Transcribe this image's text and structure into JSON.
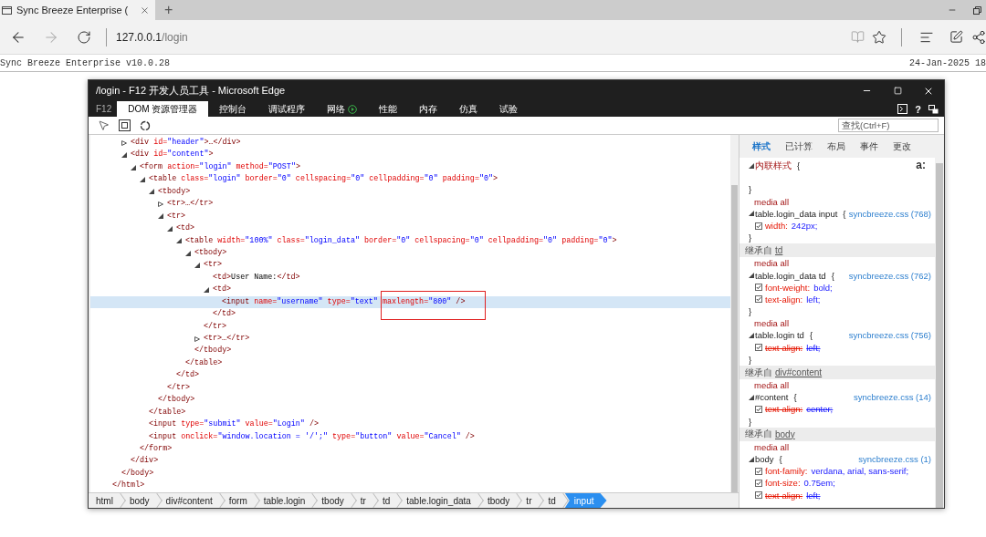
{
  "browser": {
    "tab_title": "Sync Breeze Enterprise (",
    "new_tab": "+",
    "url_host": "127.0.0.1",
    "url_path": "/login"
  },
  "page_header": {
    "title": "Sync Breeze Enterprise v10.0.28",
    "date": "24-Jan-2025 18"
  },
  "devtools": {
    "title": "/login - F12 开发人员工具 - Microsoft Edge",
    "help": "?",
    "tabs": [
      {
        "kind": "label",
        "label": "F12",
        "selected": false
      },
      {
        "kind": "tab",
        "label": "DOM 资源管理器",
        "selected": true
      },
      {
        "kind": "tab",
        "label": "控制台",
        "selected": false
      },
      {
        "kind": "tab",
        "label": "调试程序",
        "selected": false
      },
      {
        "kind": "play",
        "label": "网络",
        "selected": false
      },
      {
        "kind": "tab",
        "label": "性能",
        "selected": false
      },
      {
        "kind": "tab",
        "label": "内存",
        "selected": false
      },
      {
        "kind": "tab",
        "label": "仿真",
        "selected": false
      },
      {
        "kind": "tab",
        "label": "试验",
        "selected": false
      }
    ],
    "search": {
      "placeholder": "查找(Ctrl+F)"
    },
    "dom_tree": [
      {
        "close": [
          {
            "kind": "tag",
            "text": "</html>"
          }
        ],
        "children": [
          {
            "close": [
              {
                "kind": "tag",
                "text": "</body>"
              }
            ],
            "children": [
              {
                "selected": false,
                "expanded": false,
                "tokens": [
                  {
                    "kind": "tag",
                    "text": "<div"
                  },
                  {
                    "kind": "attr",
                    "text": " id="
                  },
                  {
                    "kind": "value",
                    "text": "\"header\""
                  },
                  {
                    "kind": "tag",
                    "text": ">…</div>"
                  }
                ]
              },
              {
                "selected": false,
                "expanded": true,
                "tokens": [
                  {
                    "kind": "tag",
                    "text": "<div"
                  },
                  {
                    "kind": "attr",
                    "text": " id="
                  },
                  {
                    "kind": "value",
                    "text": "\"content\""
                  },
                  {
                    "kind": "tag",
                    "text": ">"
                  }
                ],
                "close": [
                  {
                    "kind": "tag",
                    "text": "</div>"
                  }
                ],
                "children": [
                  {
                    "selected": false,
                    "expanded": true,
                    "tokens": [
                      {
                        "kind": "tag",
                        "text": "<form"
                      },
                      {
                        "kind": "attr",
                        "text": " action="
                      },
                      {
                        "kind": "value",
                        "text": "\"login\""
                      },
                      {
                        "kind": "attr",
                        "text": " method="
                      },
                      {
                        "kind": "value",
                        "text": "\"POST\""
                      },
                      {
                        "kind": "tag",
                        "text": ">"
                      }
                    ],
                    "close": [
                      {
                        "kind": "tag",
                        "text": "</form>"
                      }
                    ],
                    "children": [
                      {
                        "selected": false,
                        "expanded": true,
                        "tokens": [
                          {
                            "kind": "tag",
                            "text": "<table"
                          },
                          {
                            "kind": "attr",
                            "text": " class="
                          },
                          {
                            "kind": "value",
                            "text": "\"login\""
                          },
                          {
                            "kind": "attr",
                            "text": " border="
                          },
                          {
                            "kind": "value",
                            "text": "\"0\""
                          },
                          {
                            "kind": "attr",
                            "text": " cellspacing="
                          },
                          {
                            "kind": "value",
                            "text": "\"0\""
                          },
                          {
                            "kind": "attr",
                            "text": " cellpadding="
                          },
                          {
                            "kind": "value",
                            "text": "\"0\""
                          },
                          {
                            "kind": "attr",
                            "text": " padding="
                          },
                          {
                            "kind": "value",
                            "text": "\"0\""
                          },
                          {
                            "kind": "tag",
                            "text": ">"
                          }
                        ],
                        "close": [
                          {
                            "kind": "tag",
                            "text": "</table>"
                          }
                        ],
                        "children": [
                          {
                            "selected": false,
                            "expanded": true,
                            "tokens": [
                              {
                                "kind": "tag",
                                "text": "<tbody>"
                              }
                            ],
                            "close": [
                              {
                                "kind": "tag",
                                "text": "</tbody>"
                              }
                            ],
                            "children": [
                              {
                                "selected": false,
                                "expanded": false,
                                "tokens": [
                                  {
                                    "kind": "tag",
                                    "text": "<tr>…</tr>"
                                  }
                                ]
                              },
                              {
                                "selected": false,
                                "expanded": true,
                                "tokens": [
                                  {
                                    "kind": "tag",
                                    "text": "<tr>"
                                  }
                                ],
                                "close": [
                                  {
                                    "kind": "tag",
                                    "text": "</tr>"
                                  }
                                ],
                                "children": [
                                  {
                                    "selected": false,
                                    "expanded": true,
                                    "tokens": [
                                      {
                                        "kind": "tag",
                                        "text": "<td>"
                                      }
                                    ],
                                    "close": [
                                      {
                                        "kind": "tag",
                                        "text": "</td>"
                                      }
                                    ],
                                    "children": [
                                      {
                                        "selected": false,
                                        "expanded": true,
                                        "tokens": [
                                          {
                                            "kind": "tag",
                                            "text": "<table"
                                          },
                                          {
                                            "kind": "attr",
                                            "text": " width="
                                          },
                                          {
                                            "kind": "value",
                                            "text": "\"100%\""
                                          },
                                          {
                                            "kind": "attr",
                                            "text": " class="
                                          },
                                          {
                                            "kind": "value",
                                            "text": "\"login_data\""
                                          },
                                          {
                                            "kind": "attr",
                                            "text": " border="
                                          },
                                          {
                                            "kind": "value",
                                            "text": "\"0\""
                                          },
                                          {
                                            "kind": "attr",
                                            "text": " cellspacing="
                                          },
                                          {
                                            "kind": "value",
                                            "text": "\"0\""
                                          },
                                          {
                                            "kind": "attr",
                                            "text": " cellpadding="
                                          },
                                          {
                                            "kind": "value",
                                            "text": "\"0\""
                                          },
                                          {
                                            "kind": "attr",
                                            "text": " padding="
                                          },
                                          {
                                            "kind": "value",
                                            "text": "\"0\""
                                          },
                                          {
                                            "kind": "tag",
                                            "text": ">"
                                          }
                                        ],
                                        "close": [
                                          {
                                            "kind": "tag",
                                            "text": "</table>"
                                          }
                                        ],
                                        "children": [
                                          {
                                            "selected": false,
                                            "expanded": true,
                                            "tokens": [
                                              {
                                                "kind": "tag",
                                                "text": "<tbody>"
                                              }
                                            ],
                                            "close": [
                                              {
                                                "kind": "tag",
                                                "text": "</tbody>"
                                              }
                                            ],
                                            "children": [
                                              {
                                                "selected": false,
                                                "expanded": true,
                                                "tokens": [
                                                  {
                                                    "kind": "tag",
                                                    "text": "<tr>"
                                                  }
                                                ],
                                                "close": [
                                                  {
                                                    "kind": "tag",
                                                    "text": "</tr>"
                                                  }
                                                ],
                                                "children": [
                                                  {
                                                    "selected": false,
                                                    "tokens": [
                                                      {
                                                        "kind": "tag",
                                                        "text": "<td>"
                                                      },
                                                      {
                                                        "kind": "text",
                                                        "text": "User Name:"
                                                      },
                                                      {
                                                        "kind": "tag",
                                                        "text": "</td>"
                                                      }
                                                    ]
                                                  },
                                                  {
                                                    "selected": false,
                                                    "expanded": true,
                                                    "tokens": [
                                                      {
                                                        "kind": "tag",
                                                        "text": "<td>"
                                                      }
                                                    ],
                                                    "close": [
                                                      {
                                                        "kind": "tag",
                                                        "text": "</td>"
                                                      }
                                                    ],
                                                    "children": [
                                                      {
                                                        "selected": true,
                                                        "tokens": [
                                                          {
                                                            "kind": "tag",
                                                            "text": "<input"
                                                          },
                                                          {
                                                            "kind": "attr",
                                                            "text": " name="
                                                          },
                                                          {
                                                            "kind": "value",
                                                            "text": "\"username\""
                                                          },
                                                          {
                                                            "kind": "attr",
                                                            "text": " type="
                                                          },
                                                          {
                                                            "kind": "value",
                                                            "text": "\"text\""
                                                          },
                                                          {
                                                            "kind": "attr",
                                                            "text": " maxlength=",
                                                            "boxed": true
                                                          },
                                                          {
                                                            "kind": "value",
                                                            "text": "\"800\"",
                                                            "boxed": true
                                                          },
                                                          {
                                                            "kind": "tag",
                                                            "text": " />"
                                                          }
                                                        ]
                                                      }
                                                    ]
                                                  }
                                                ]
                                              },
                                              {
                                                "selected": false,
                                                "expanded": false,
                                                "tokens": [
                                                  {
                                                    "kind": "tag",
                                                    "text": "<tr>…</tr>"
                                                  }
                                                ]
                                              }
                                            ]
                                          }
                                        ]
                                      }
                                    ]
                                  }
                                ]
                              }
                            ]
                          }
                        ]
                      },
                      {
                        "selected": false,
                        "tokens": [
                          {
                            "kind": "tag",
                            "text": "<input"
                          },
                          {
                            "kind": "attr",
                            "text": " type="
                          },
                          {
                            "kind": "value",
                            "text": "\"submit\""
                          },
                          {
                            "kind": "attr",
                            "text": " value="
                          },
                          {
                            "kind": "value",
                            "text": "\"Login\""
                          },
                          {
                            "kind": "tag",
                            "text": " />"
                          }
                        ]
                      },
                      {
                        "selected": false,
                        "tokens": [
                          {
                            "kind": "tag",
                            "text": "<input"
                          },
                          {
                            "kind": "attr",
                            "text": " onclick="
                          },
                          {
                            "kind": "value",
                            "text": "\"window.location = '/';\""
                          },
                          {
                            "kind": "attr",
                            "text": " type="
                          },
                          {
                            "kind": "value",
                            "text": "\"button\""
                          },
                          {
                            "kind": "attr",
                            "text": " value="
                          },
                          {
                            "kind": "value",
                            "text": "\"Cancel\""
                          },
                          {
                            "kind": "tag",
                            "text": " />"
                          }
                        ]
                      }
                    ]
                  }
                ]
              }
            ]
          }
        ]
      }
    ],
    "breadcrumbs": [
      {
        "label": "html",
        "selected": false
      },
      {
        "label": "body",
        "selected": false
      },
      {
        "label": "div#content",
        "selected": false
      },
      {
        "label": "form",
        "selected": false
      },
      {
        "label": "table.login",
        "selected": false
      },
      {
        "label": "tbody",
        "selected": false
      },
      {
        "label": "tr",
        "selected": false
      },
      {
        "label": "td",
        "selected": false
      },
      {
        "label": "table.login_data",
        "selected": false
      },
      {
        "label": "tbody",
        "selected": false
      },
      {
        "label": "tr",
        "selected": false
      },
      {
        "label": "td",
        "selected": false
      },
      {
        "label": "input",
        "selected": true
      }
    ],
    "style_tabs": [
      {
        "label": "样式",
        "selected": true
      },
      {
        "label": "已计算",
        "selected": false
      },
      {
        "label": "布局",
        "selected": false
      },
      {
        "label": "事件",
        "selected": false
      },
      {
        "label": "更改",
        "selected": false
      }
    ],
    "style_sections": [
      {
        "kind": "inline",
        "selector": "内联样式",
        "open": "{",
        "close": "}",
        "expanded": true,
        "pseudo_button": "a:"
      },
      {
        "kind": "rule",
        "media": "media all",
        "selector": "table.login_data input",
        "open": "{",
        "close": "}",
        "expanded": true,
        "source": "syncbreeze.css (768)",
        "props": [
          {
            "name": "width:",
            "value": "242px;",
            "checked": true,
            "overridden": false
          }
        ]
      },
      {
        "kind": "inherited",
        "label": "继承自",
        "from": "td"
      },
      {
        "kind": "rule",
        "media": "media all",
        "selector": "table.login_data td",
        "open": "{",
        "close": "}",
        "expanded": true,
        "source": "syncbreeze.css (762)",
        "props": [
          {
            "name": "font-weight:",
            "value": "bold;",
            "checked": true,
            "overridden": false
          },
          {
            "name": "text-align:",
            "value": "left;",
            "checked": true,
            "overridden": false
          }
        ]
      },
      {
        "kind": "rule",
        "media": "media all",
        "selector": "table.login td",
        "open": "{",
        "close": "}",
        "expanded": true,
        "source": "syncbreeze.css (756)",
        "props": [
          {
            "name": "text-align:",
            "value": "left;",
            "checked": true,
            "overridden": true
          }
        ]
      },
      {
        "kind": "inherited",
        "label": "继承自",
        "from": "div#content"
      },
      {
        "kind": "rule",
        "media": "media all",
        "selector": "#content",
        "open": "{",
        "close": "}",
        "expanded": true,
        "source": "syncbreeze.css (14)",
        "props": [
          {
            "name": "text-align:",
            "value": "center;",
            "checked": true,
            "overridden": true
          }
        ]
      },
      {
        "kind": "inherited",
        "label": "继承自",
        "from": "body"
      },
      {
        "kind": "rule",
        "media": "media all",
        "selector": "body",
        "open": "{",
        "expanded": true,
        "source": "syncbreeze.css (1)",
        "props": [
          {
            "name": "font-family:",
            "value": "verdana, arial, sans-serif;",
            "checked": true,
            "overridden": false
          },
          {
            "name": "font-size:",
            "value": "0.75em;",
            "checked": true,
            "overridden": false
          },
          {
            "name": "text-align:",
            "value": "left;",
            "checked": true,
            "overridden": true
          }
        ]
      }
    ]
  }
}
